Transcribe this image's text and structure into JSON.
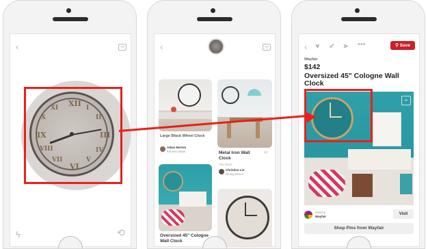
{
  "phone1": {
    "back_icon": "chevron-left-icon",
    "image_icon": "image-icon",
    "flash_icon": "lightning-icon",
    "rotate_icon": "rotate-camera-icon"
  },
  "phone2": {
    "pins": [
      {
        "title": "Large Black Wheel Clock",
        "user": "Adam Barton",
        "board": "Kitchen Ideas"
      },
      {
        "title": "Metal Iron Wall Clock",
        "count": "30",
        "source": "The Store",
        "user": "Christine Lin",
        "board": "Dining Decor"
      },
      {
        "title": "Oversized 45\" Cologne Wall Clock"
      }
    ]
  },
  "phone3": {
    "save_label": "Save",
    "brand": "Wayfair",
    "price": "$142",
    "title": "Oversized 45\" Cologne Wall Clock",
    "sold_by": "Sold by",
    "seller": "Wayfair",
    "visit_label": "Visit",
    "shop_label": "Shop Pins from Wayfair"
  },
  "colors": {
    "highlight_red": "#e8201a",
    "pinterest_red": "#cb2027"
  }
}
